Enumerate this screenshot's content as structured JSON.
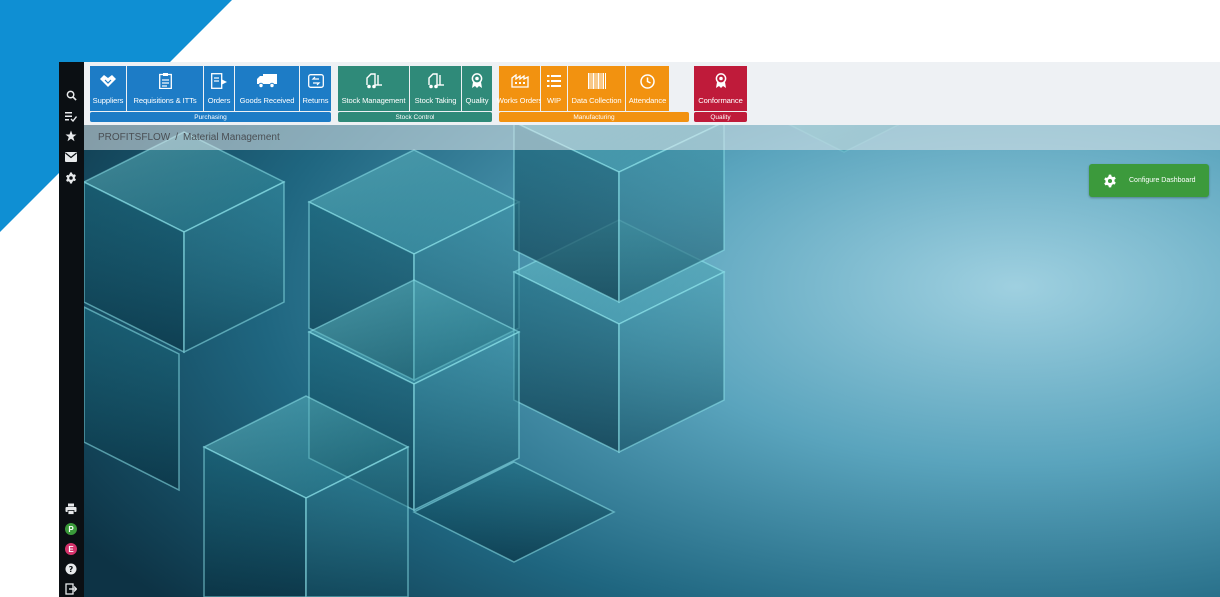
{
  "colors": {
    "purchasing": "#1d7cc6",
    "stock_control": "#2f8a79",
    "manufacturing": "#f29210",
    "quality": "#bf1b3a",
    "configure": "#3c9a3c",
    "sidebar": "#0b0f13"
  },
  "sidebar": {
    "top_icons": [
      "search-icon",
      "list-check-icon",
      "star-icon",
      "envelope-icon",
      "gear-icon"
    ],
    "bottom": {
      "print_icon": "print-icon",
      "user_p_label": "P",
      "user_e_label": "E",
      "help_icon": "question-icon",
      "logout_icon": "sign-out-icon"
    }
  },
  "toolbar": {
    "groups": [
      {
        "label": "Purchasing",
        "tiles": [
          {
            "label": "Suppliers",
            "icon": "handshake-icon"
          },
          {
            "label": "Requisitions & ITTs",
            "icon": "checklist-icon"
          },
          {
            "label": "Orders",
            "icon": "document-arrow-icon"
          },
          {
            "label": "Goods Received",
            "icon": "truck-icon"
          },
          {
            "label": "Returns",
            "icon": "return-icon"
          }
        ]
      },
      {
        "label": "Stock Control",
        "tiles": [
          {
            "label": "Stock Management",
            "icon": "forklift-icon"
          },
          {
            "label": "Stock Taking",
            "icon": "forklift-icon"
          },
          {
            "label": "Quality",
            "icon": "award-icon"
          }
        ]
      },
      {
        "label": "Manufacturing",
        "tiles": [
          {
            "label": "Works Orders",
            "icon": "factory-icon"
          },
          {
            "label": "WIP",
            "icon": "list-icon"
          },
          {
            "label": "Data Collection",
            "icon": "barcode-icon"
          },
          {
            "label": "Attendance",
            "icon": "clock-icon"
          }
        ]
      },
      {
        "label": "Quality",
        "tiles": [
          {
            "label": "Conformance",
            "icon": "award-icon"
          }
        ]
      }
    ]
  },
  "breadcrumb": {
    "root": "PROFITSFLOW",
    "separator": "/",
    "current": "Material Management"
  },
  "configure_button": {
    "label": "Configure Dashboard",
    "icon": "gear-icon"
  }
}
